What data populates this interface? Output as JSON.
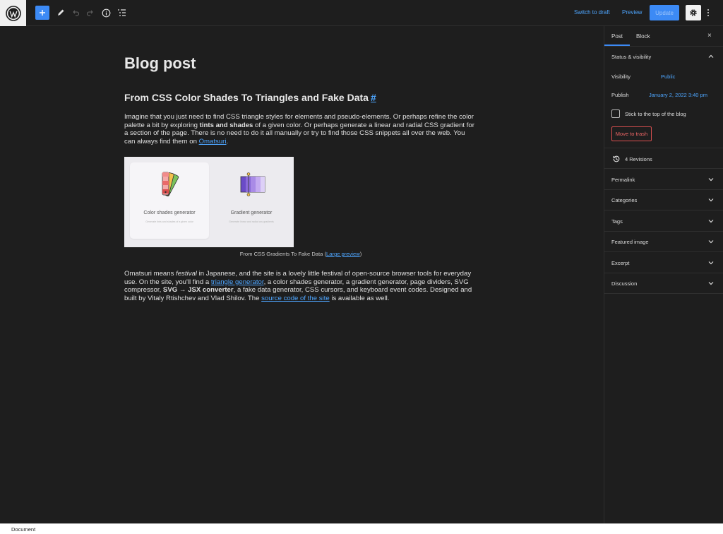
{
  "toolbar": {
    "switch_to_draft": "Switch to draft",
    "preview": "Preview",
    "update": "Update",
    "accent_color": "#3c8af5"
  },
  "editor": {
    "post_title": "Blog post",
    "heading": "From CSS Color Shades To Triangles and Fake Data",
    "heading_anchor": "#",
    "para1": {
      "t1": "Imagine that you just need to find CSS triangle styles for elements and pseudo-elements. Or perhaps refine the color palette a bit by exploring ",
      "b1": "tints and shades",
      "t2": " of a given color. Or perhaps generate a linear and radial CSS gradient for a section of the page. There is no need to do it all manually or try to find those CSS snippets all over the web. You can always find them on ",
      "link": "Omatsuri",
      "t3": "."
    },
    "figure": {
      "card1_title": "Color shades generator",
      "card1_sub": "Generate tints and shades of a given color",
      "card2_title": "Gradient generator",
      "card2_sub": "Generate linear and radial css gradients"
    },
    "caption": {
      "text": "From CSS Gradients To Fake Data (",
      "link": "Large preview",
      "close": ")"
    },
    "para2": {
      "t1": "Omatsuri means ",
      "em": "festival",
      "t2": " in Japanese, and the site is a lovely little festival of open-source browser tools for everyday use. On the site, you'll find a ",
      "link1": "triangle generator",
      "t3": ", a color shades generator, a gradient generator, page dividers, SVG compressor, ",
      "b1": "SVG → JSX converter",
      "t4": ", a fake data generator, CSS cursors, and keyboard event codes. Designed and built by Vitaly Rtishchev and Vlad Shilov. The ",
      "link2": "source code of the site",
      "t5": " is available as well."
    }
  },
  "sidebar": {
    "tab_post": "Post",
    "tab_block": "Block",
    "close": "×",
    "status_title": "Status & visibility",
    "visibility_label": "Visibility",
    "visibility_value": "Public",
    "publish_label": "Publish",
    "publish_value": "January 2, 2022 3:40 pm",
    "stick_label": "Stick to the top of the blog",
    "trash": "Move to trash",
    "revisions": "4 Revisions",
    "panels": [
      "Permalink",
      "Categories",
      "Tags",
      "Featured image",
      "Excerpt",
      "Discussion"
    ]
  },
  "footer": {
    "breadcrumb": "Document"
  }
}
